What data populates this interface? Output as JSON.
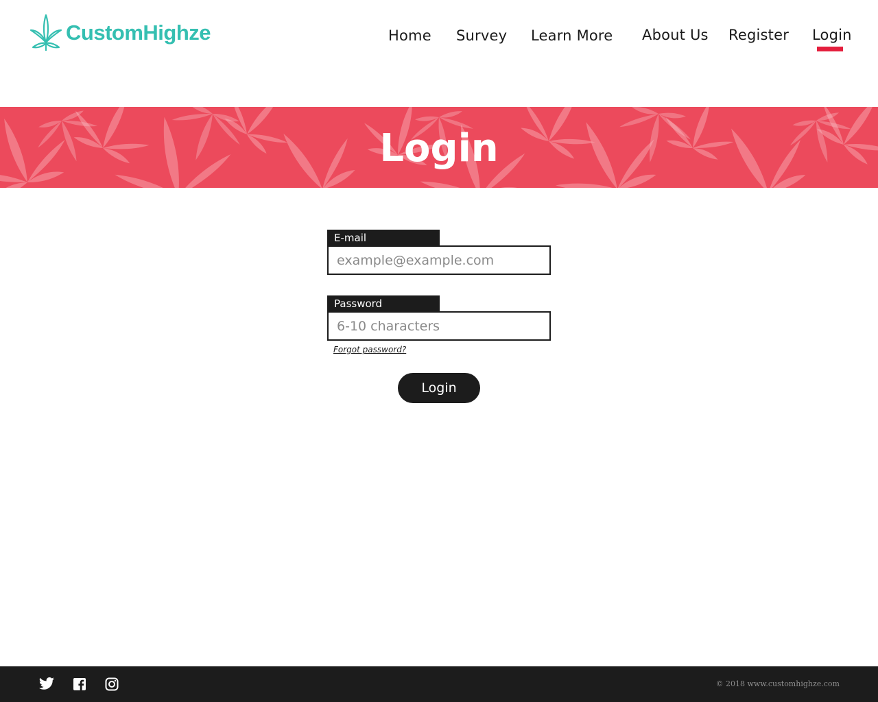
{
  "brand": {
    "name": "CustomHighze",
    "color": "#35bfb1",
    "icon": "cannabis-leaf-icon"
  },
  "nav": {
    "items": [
      {
        "label": "Home"
      },
      {
        "label": "Survey"
      },
      {
        "label": "Learn More"
      },
      {
        "label": "About Us"
      },
      {
        "label": "Register"
      },
      {
        "label": "Login",
        "active": true
      }
    ],
    "active_color": "#e41f3d"
  },
  "banner": {
    "title": "Login",
    "color": "#ec4a5c"
  },
  "form": {
    "email": {
      "label": "E-mail",
      "placeholder": "example@example.com",
      "value": ""
    },
    "password": {
      "label": "Password",
      "placeholder": "6-10 characters",
      "value": ""
    },
    "forgot_label": "Forgot password?",
    "submit_label": "Login"
  },
  "footer": {
    "social_icons": [
      "twitter-icon",
      "facebook-icon",
      "instagram-icon"
    ],
    "copyright": "© 2018 www.customhighze.com"
  }
}
